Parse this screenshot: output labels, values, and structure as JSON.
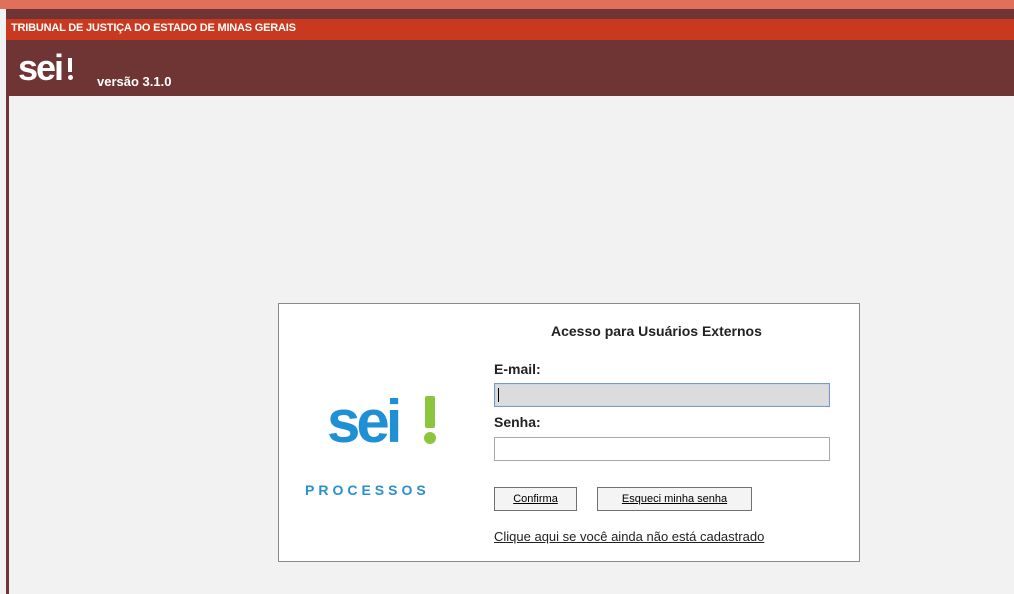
{
  "header": {
    "organization": "TRIBUNAL DE JUSTIÇA DO ESTADO DE MINAS GERAIS",
    "logo_text": "sei",
    "version": "versão 3.1.0"
  },
  "login": {
    "logo_text": "sei",
    "logo_subtitle": "PROCESSOS",
    "title": "Acesso para Usuários Externos",
    "email_label": "E-mail:",
    "email_value": "",
    "password_label": "Senha:",
    "password_value": "",
    "confirm_button": "Confirma",
    "forgot_button": "Esqueci minha senha",
    "register_link": "Clique aqui se você ainda não está cadastrado"
  },
  "colors": {
    "banner_dark": "#6f3535",
    "banner_red": "#c8391f",
    "logo_blue": "#1f8fd6",
    "logo_green": "#8cc63f"
  }
}
